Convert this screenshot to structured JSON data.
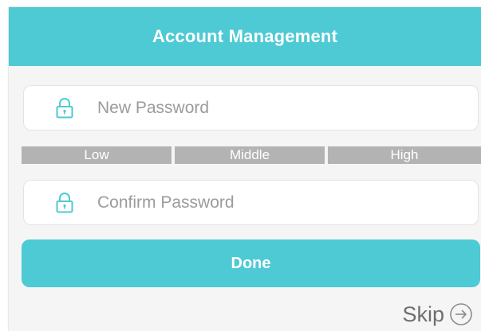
{
  "header": {
    "title": "Account Management"
  },
  "new_password": {
    "placeholder": "New Password",
    "icon": "lock-icon"
  },
  "strength": {
    "low": "Low",
    "middle": "Middle",
    "high": "High"
  },
  "confirm_password": {
    "placeholder": "Confirm Password",
    "icon": "lock-icon"
  },
  "done_button": {
    "label": "Done"
  },
  "skip": {
    "label": "Skip",
    "icon": "arrow-right-circle-icon"
  },
  "colors": {
    "accent": "#4ecad4",
    "strength_bar": "#b3b3b3",
    "placeholder_text": "#9b9b9b",
    "background": "#f5f5f5"
  }
}
